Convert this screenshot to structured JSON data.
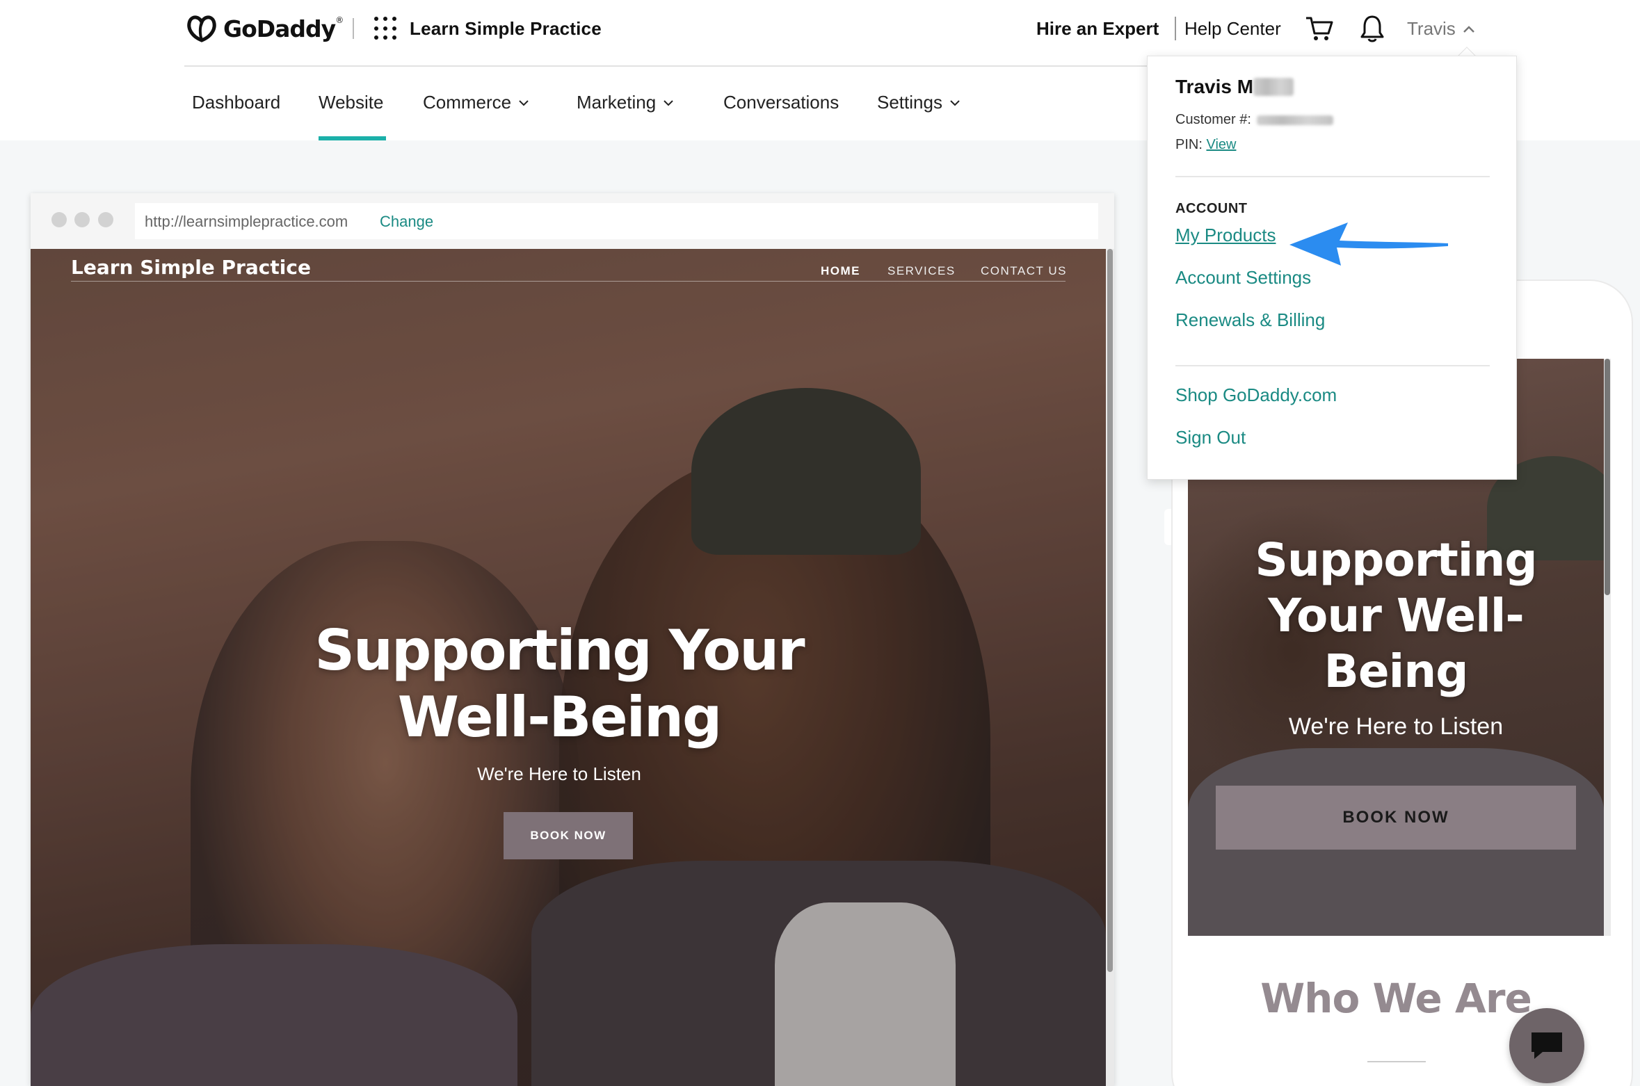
{
  "header": {
    "brand": "GoDaddy",
    "brand_mark": "®",
    "site_name": "Learn Simple Practice",
    "hire_expert": "Hire an Expert",
    "help_center": "Help Center",
    "user_name": "Travis"
  },
  "nav": {
    "items": [
      {
        "label": "Dashboard"
      },
      {
        "label": "Website"
      },
      {
        "label": "Commerce"
      },
      {
        "label": "Marketing"
      },
      {
        "label": "Conversations"
      },
      {
        "label": "Settings"
      }
    ],
    "active": "Website"
  },
  "preview": {
    "url": "http://learnsimplepractice.com",
    "change_label": "Change",
    "site_logo": "Learn Simple Practice",
    "site_nav": [
      "HOME",
      "SERVICES",
      "CONTACT US"
    ],
    "hero_title": "Supporting Your Well-Being",
    "hero_subtitle": "We're Here to Listen",
    "book_button": "BOOK NOW"
  },
  "mobile": {
    "hero_title": "Supporting Your Well-Being",
    "hero_subtitle": "We're Here to Listen",
    "book_button": "BOOK NOW",
    "section_title": "Who We Are"
  },
  "dropdown": {
    "name": "Travis M",
    "customer_label": "Customer #:",
    "pin_label": "PIN:",
    "pin_link": "View",
    "account_heading": "ACCOUNT",
    "links": [
      "My Products",
      "Account Settings",
      "Renewals & Billing"
    ],
    "links2": [
      "Shop GoDaddy.com",
      "Sign Out"
    ]
  },
  "colors": {
    "accent": "#1bb0a9",
    "link": "#1a8a83",
    "annotation_arrow": "#2b8cf0"
  },
  "icons": [
    "godaddy-logo-icon",
    "apps-grid-icon",
    "cart-icon",
    "bell-icon",
    "chevron-up-icon",
    "chevron-down-icon",
    "chat-icon",
    "annotation-arrow-icon"
  ]
}
